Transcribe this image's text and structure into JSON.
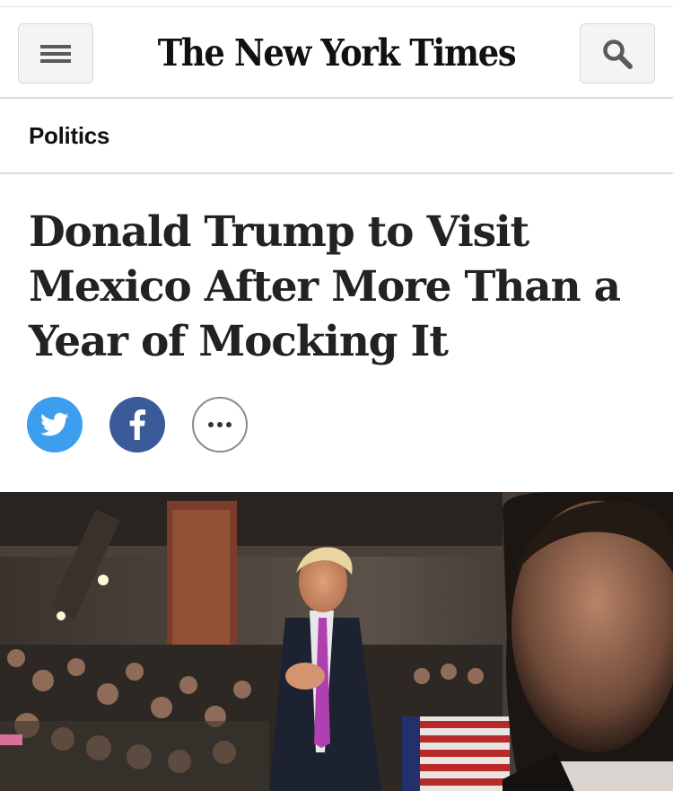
{
  "header": {
    "masthead": "The New York Times",
    "menu_icon": "hamburger-menu-icon",
    "search_icon": "search-icon"
  },
  "section": {
    "label": "Politics"
  },
  "article": {
    "headline": "Donald Trump to Visit Mexico After More Than a Year of Mocking It"
  },
  "share": {
    "twitter_icon": "twitter-bird-icon",
    "facebook_icon": "facebook-f-icon",
    "more_icon": "more-options-ellipsis-icon"
  },
  "colors": {
    "twitter": "#3d9ef0",
    "facebook": "#3b5a9a",
    "rule": "#dcdcdc",
    "button_bg": "#f4f4f4"
  }
}
